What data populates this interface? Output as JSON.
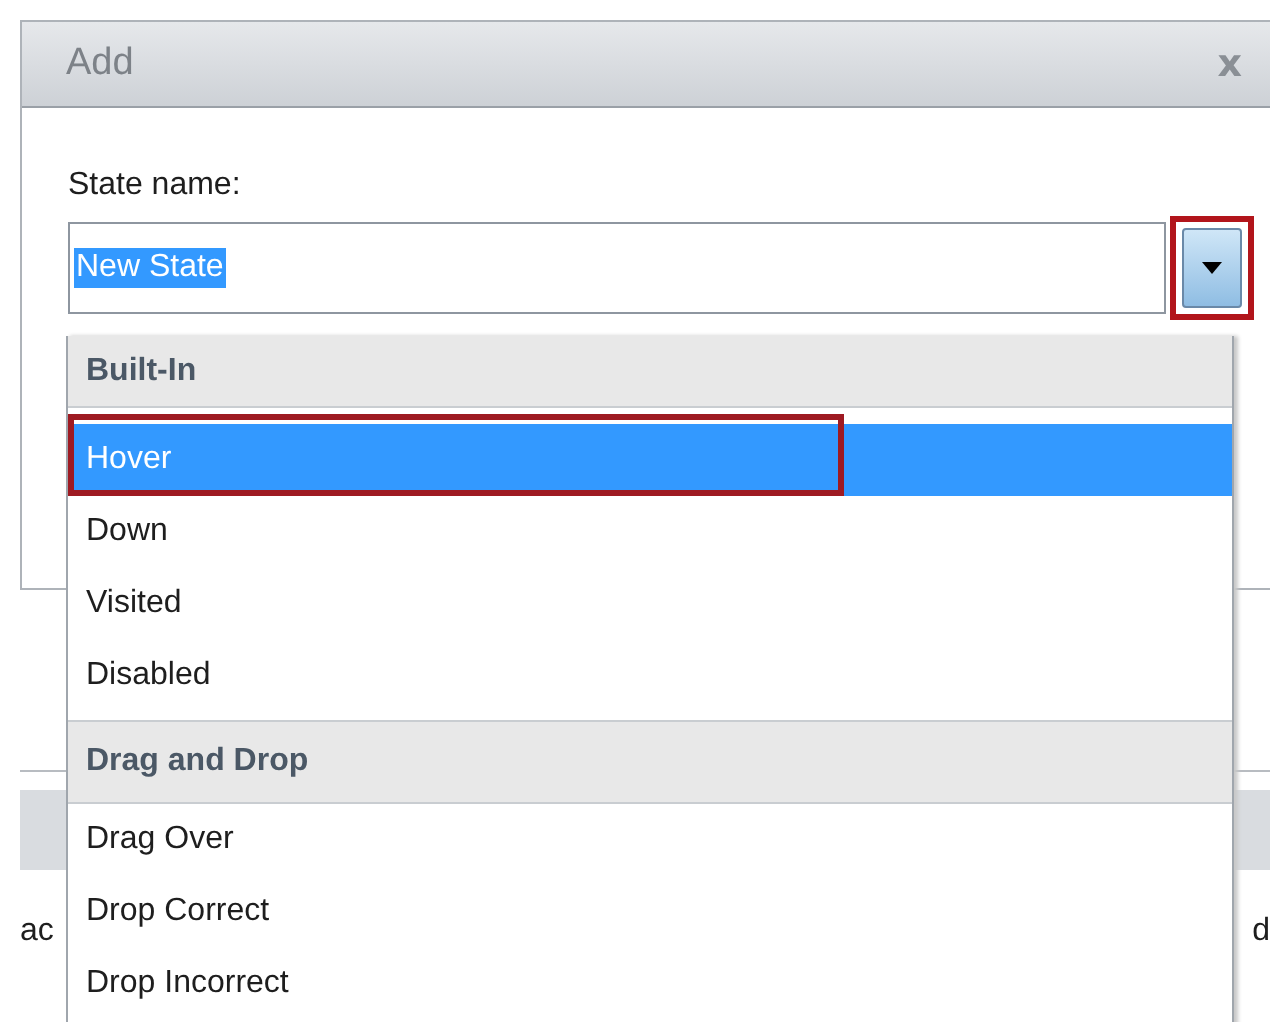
{
  "dialog": {
    "title": "Add",
    "close": "x",
    "field_label": "State name:",
    "field_value": "New State",
    "value_selected": true,
    "dropdown_button": {
      "annotated": true
    }
  },
  "dropdown": {
    "groups": [
      {
        "header": "Built-In",
        "items": [
          {
            "label": "Hover",
            "selected": true,
            "annotated": true
          },
          {
            "label": "Down",
            "selected": false,
            "annotated": false
          },
          {
            "label": "Visited",
            "selected": false,
            "annotated": false
          },
          {
            "label": "Disabled",
            "selected": false,
            "annotated": false
          }
        ]
      },
      {
        "header": "Drag and Drop",
        "items": [
          {
            "label": "Drag Over",
            "selected": false,
            "annotated": false
          },
          {
            "label": "Drop Correct",
            "selected": false,
            "annotated": false
          },
          {
            "label": "Drop Incorrect",
            "selected": false,
            "annotated": false
          }
        ]
      }
    ]
  },
  "background": {
    "left_text": "ac",
    "right_text": "d"
  }
}
